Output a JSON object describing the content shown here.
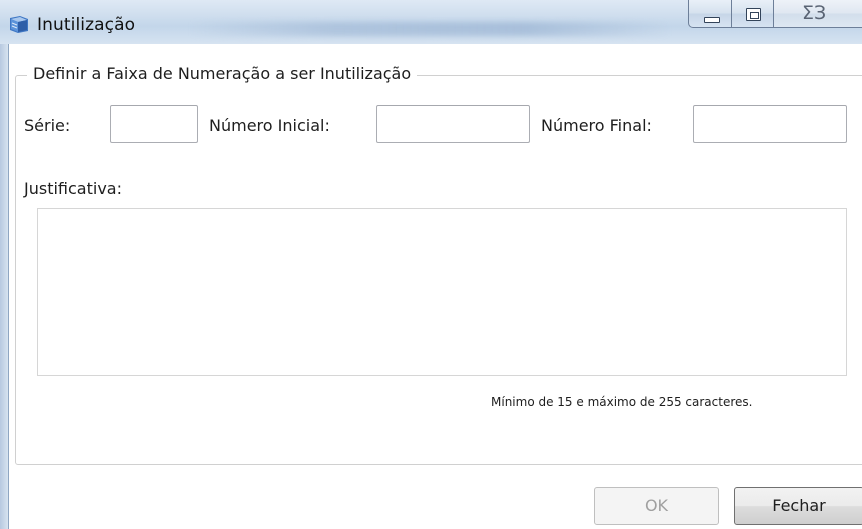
{
  "window": {
    "title": "Inutilização",
    "icon": "app-book-icon"
  },
  "caption_buttons": {
    "minimize_icon": "minimize-icon",
    "maximize_icon": "maximize-icon",
    "close_glyph": "ΣЗ"
  },
  "group": {
    "legend": "Definir a Faixa de Numeração a ser Inutilização"
  },
  "fields": {
    "serie_label": "Série:",
    "serie_value": "",
    "numero_inicial_label": "Número Inicial:",
    "numero_inicial_value": "",
    "numero_final_label": "Número Final:",
    "numero_final_value": ""
  },
  "justificativa": {
    "label": "Justificativa:",
    "value": "",
    "hint": "Mínimo de 15 e máximo de 255 caracteres."
  },
  "buttons": {
    "ok_label": "OK",
    "ok_enabled": false,
    "fechar_label": "Fechar"
  }
}
